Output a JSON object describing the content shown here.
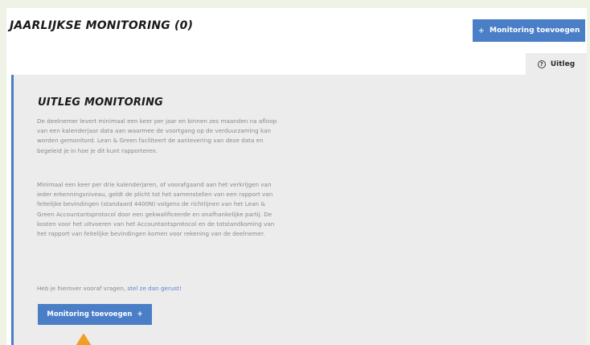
{
  "header": {
    "title": "JAARLIJKSE MONITORING (0)",
    "add_button_label": "Monitoring toevoegen",
    "add_button_icon": "plus-icon"
  },
  "tabs": [
    {
      "label": "Uitleg",
      "icon": "help-circle-icon"
    }
  ],
  "explanation": {
    "title": "UITLEG MONITORING",
    "paragraph1": "De deelnemer levert minimaal een keer per jaar en binnen zes maanden na afloop van een kalenderjaar data aan waarmee de voortgang op de verduurzaming kan worden gemonitord. Lean & Green faciliteert de aanlevering van deze data en begeleid je in hoe je dit kunt rapporteren.",
    "paragraph2": "Minimaal een keer per drie kalenderjaren, of voorafgaand aan het verkrijgen van ieder erkenningsniveau, geldt de plicht tot het samenstellen van een rapport van feitelijke bevindingen (standaard 4400N) volgens de richtlijnen van het Lean & Green Accountantsprotocol door een gekwalificeerde en onafhankelijke partij. De kosten voor het uitvoeren van het Accountantsprotocol en de totstandkoming van het rapport van feitelijke bevindingen komen voor rekening van de deelnemer.",
    "paragraph3_prefix": "Heb je hierover vooraf vragen, ",
    "paragraph3_link": "stel ze dan gerust!",
    "button_label": "Monitoring toevoegen"
  },
  "colors": {
    "accent": "#4a7fc8",
    "annotation_arrow": "#f0a020"
  }
}
